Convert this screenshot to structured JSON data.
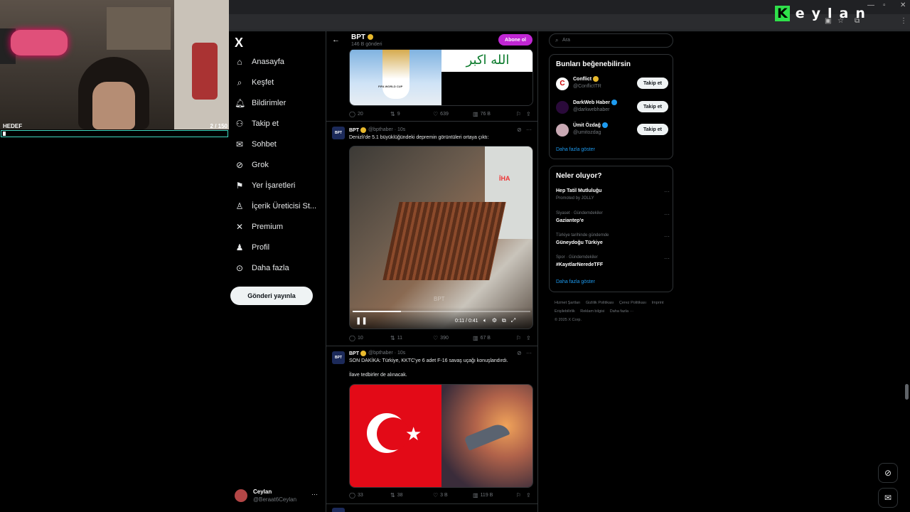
{
  "overlay": {
    "goal_label": "HEDEF",
    "goal_count": "2 / 150",
    "goal_progress": 0.013,
    "brand": "Keylan"
  },
  "nav": {
    "logo": "X",
    "items": [
      {
        "label": "Anasayfa",
        "icon": "home-icon"
      },
      {
        "label": "Keşfet",
        "icon": "search-icon"
      },
      {
        "label": "Bildirimler",
        "icon": "bell-icon"
      },
      {
        "label": "Takip et",
        "icon": "person-plus-icon"
      },
      {
        "label": "Sohbet",
        "icon": "mail-icon"
      },
      {
        "label": "Grok",
        "icon": "grok-icon"
      },
      {
        "label": "Yer İşaretleri",
        "icon": "bookmark-icon"
      },
      {
        "label": "İçerik Üreticisi St...",
        "icon": "creator-icon"
      },
      {
        "label": "Premium",
        "icon": "x-icon"
      },
      {
        "label": "Profil",
        "icon": "person-icon"
      },
      {
        "label": "Daha fazla",
        "icon": "more-circle-icon"
      }
    ],
    "post_button": "Gönderi yayınla",
    "account": {
      "name": "Ceylan",
      "handle": "@Beraat6Ceylan",
      "more": "···"
    }
  },
  "feed_header": {
    "title": "BPT",
    "subtitle": "146 B gönderi",
    "subscribe": "Abone ol"
  },
  "tweets": [
    {
      "media_text": "الله اكبر",
      "trophy_text": "FIFA WORLD CUP",
      "stats": {
        "replies": "20",
        "reposts": "9",
        "likes": "639",
        "views": "76 B"
      }
    },
    {
      "avatar_text": "BPT",
      "name": "BPT",
      "handle": "@bpthaber",
      "time": "10s",
      "text": "Denizli'de 5.1 büyüklüğündeki depremin görüntüleri ortaya çıktı:",
      "video": {
        "time": "0:11 / 0:41",
        "progress": 0.27,
        "watermark_top": "İHA",
        "watermark_bottom": "BPT"
      },
      "stats": {
        "replies": "10",
        "reposts": "11",
        "likes": "390",
        "views": "67 B"
      }
    },
    {
      "avatar_text": "BPT",
      "name": "BPT",
      "handle": "@bpthaber",
      "time": "10s",
      "text": "SON DAKİKA: Türkiye, KKTC'ye 6 adet F-16 savaş uçağı konuşlandırdı.",
      "text2": "İlave tedbirler de alınacak.",
      "stats": {
        "replies": "33",
        "reposts": "38",
        "likes": "3 B",
        "views": "119 B"
      }
    }
  ],
  "right": {
    "search_placeholder": "Ara",
    "wtf_title": "Bunları beğenebilirsin",
    "wtf": [
      {
        "name": "Conflict",
        "handle": "@ConflictTR",
        "button": "Takip et",
        "avatar_color": "#ffffff",
        "badge": "gold"
      },
      {
        "name": "DarkWeb Haber",
        "handle": "@darkwebhaber",
        "button": "Takip et",
        "avatar_color": "#2a0a3a",
        "badge": "blue"
      },
      {
        "name": "Ümit Özdağ",
        "handle": "@umitozdag",
        "button": "Takip et",
        "avatar_color": "#c9a9b4",
        "badge": "blue"
      }
    ],
    "wtf_more": "Daha fazla göster",
    "trends_title": "Neler oluyor?",
    "trends": [
      {
        "context": "",
        "name": "Hep Tatil Mutluluğu",
        "promo": "Promoted by JOLLY"
      },
      {
        "context": "Siyaset · Gündemdekiler",
        "name": "Gaziantep'e",
        "promo": ""
      },
      {
        "context": "Türkiye tarihinde gündemde",
        "name": "Güneydoğu Türkiye",
        "promo": ""
      },
      {
        "context": "Spor · Gündemdekiler",
        "name": "#KayıtlarNeredeTFF",
        "promo": ""
      }
    ],
    "trends_more": "Daha fazla göster",
    "footer": [
      "Hizmet Şartları",
      "Gizlilik Politikası",
      "Çerez Politikası",
      "Imprint",
      "Erişilebilirlik",
      "Reklam bilgisi",
      "Daha fazla ···",
      "© 2025 X Corp."
    ]
  }
}
